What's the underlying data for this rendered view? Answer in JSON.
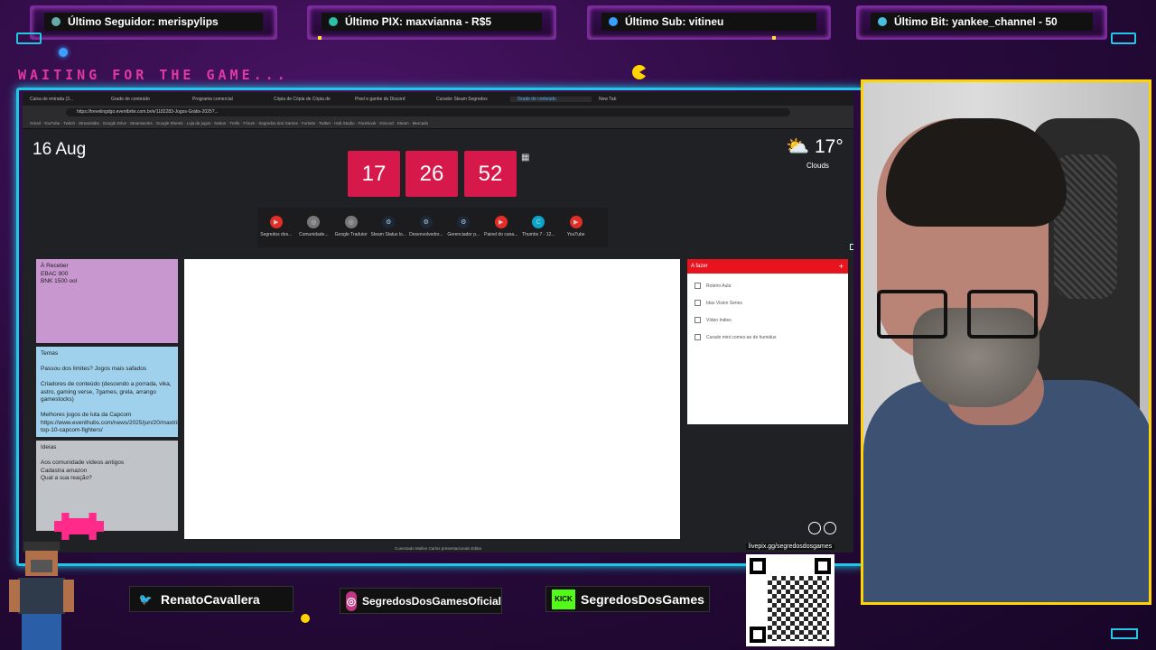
{
  "alerts": {
    "follower": "Último Seguidor: merispylips",
    "pix": "Último PIX: maxvianna - R$5",
    "sub": "Último Sub: vitineu",
    "bit": "Último Bit: yankee_channel - 50"
  },
  "waiting_text": "WAITING FOR THE GAME...",
  "browser": {
    "tabs": [
      "Caixa de entrada (3...",
      "Grade de conteúdo",
      "Programa comercial",
      "Cópia de Cópia de Cópia de",
      "Pixel e ganhe do Discord",
      "Curador Steam Segredos",
      "Grade de conteúdo",
      "New Tab"
    ],
    "url": "https://trevelingdgo.eventbrite.com.br/e/1182283-Jogos-Grátis-2025?...",
    "bookmarks": "Gmail · YouTube · Twitch · Streamlabs · Google Drive · Steamworks · Google Sheets · Loja de jogos · Notion · Trello · Fórum · Segredos dos Games · Fortnite · Twitter · Hub Studio · Facebook · Discord · Steam · Mercado"
  },
  "newtab": {
    "date": "16 Aug",
    "clock": {
      "hours": "17",
      "minutes": "26",
      "seconds": "52"
    },
    "weather": {
      "temp": "17°",
      "desc": "Clouds"
    },
    "shortcuts": [
      {
        "label": "Segredos dos...",
        "icon": "youtube-icon",
        "color": "#e52d27"
      },
      {
        "label": "Comunidade...",
        "icon": "globe-icon",
        "color": "#777"
      },
      {
        "label": "Google Tradutor",
        "icon": "globe-icon",
        "color": "#777"
      },
      {
        "label": "Steam Status lo...",
        "icon": "steam-icon",
        "color": "#1b2838"
      },
      {
        "label": "Desenvolvedor...",
        "icon": "steam-icon",
        "color": "#1b2838"
      },
      {
        "label": "Gerenciador p...",
        "icon": "steam-icon",
        "color": "#1b2838"
      },
      {
        "label": "Painel do cana...",
        "icon": "youtube-icon",
        "color": "#e52d27"
      },
      {
        "label": "Thumbs 7 - 12...",
        "icon": "canva-icon",
        "color": "#0aa5c9"
      },
      {
        "label": "YouTube",
        "icon": "youtube-icon",
        "color": "#e52d27"
      }
    ],
    "notes": [
      {
        "text": "À Receber\nEBAC 900\nBNK 1500 ool",
        "color": "#c897cf"
      },
      {
        "text": "Temas\n\nPassou dos limites? Jogos mais safados\n\nCriadores de conteúdo (descendo a porrada, vika, astro, gaming verse, 7games, grela, arrango gamestocks)\n\nMelhores jogos de luta da Capcom https://www.eventhubs.com/news/2025/jun/20/maxtrillen-top-10-capcom-fighters/",
        "color": "#9fd0ec"
      },
      {
        "text": "Ideias\n\nAos comunidade vídeos antigos\nCadastra amazon\nQual a sua reação?",
        "color": "#c0c4c9"
      }
    ],
    "todo": {
      "title": "A fazer",
      "items": [
        "Roteiro Aula",
        "Idas Vision Series",
        "Vídeo Indies",
        "Curado mini comes-ao de humidus"
      ]
    },
    "footnote": "Conectado Mullen Carlos presentacionais Editar"
  },
  "social": {
    "twitter": "RenatoCavallera",
    "instagram": "SegredosDosGamesOficial",
    "kick": "SegredosDosGames",
    "livepix": "livepix.gg/segredosdosgames"
  },
  "colors": {
    "neon_cyan": "#22c7e8",
    "neon_purple": "#7a2b9a",
    "clock_red": "#d6194a",
    "cam_border": "#ffd400"
  }
}
